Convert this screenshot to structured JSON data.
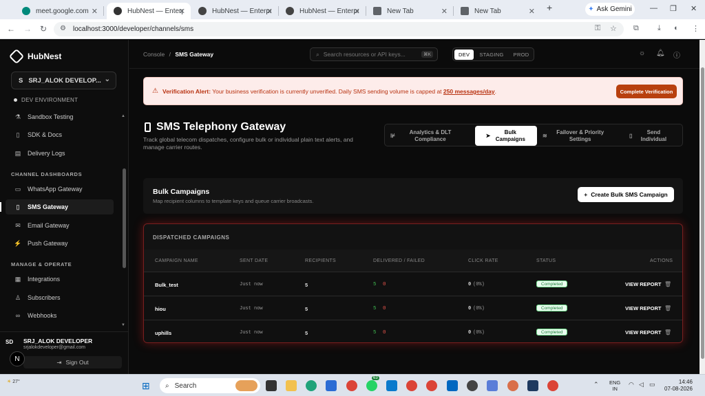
{
  "browser": {
    "tabs": [
      {
        "title": "meet.google.com",
        "active": false,
        "color": "#00897b"
      },
      {
        "title": "HubNest — Enterprise",
        "active": true,
        "color": "#333333"
      },
      {
        "title": "HubNest — Enterprise",
        "active": false,
        "color": "#333333"
      },
      {
        "title": "HubNest — Enterprise",
        "active": false,
        "color": "#333333"
      },
      {
        "title": "New Tab",
        "active": false,
        "color": "#5f6368"
      },
      {
        "title": "New Tab",
        "active": false,
        "color": "#5f6368"
      }
    ],
    "new_tab": "+",
    "gemini_label": "Ask Gemini",
    "url": "localhost:3000/developer/channels/sms"
  },
  "sidebar": {
    "brand": "HubNest",
    "org": "SRJ_ALOK DEVELOP...",
    "org_initial": "S",
    "env": "DEV ENVIRONMENT",
    "items_top": [
      {
        "label": "Sandbox Testing",
        "icon": "flask-icon"
      },
      {
        "label": "SDK & Docs",
        "icon": "book-icon"
      },
      {
        "label": "Delivery Logs",
        "icon": "file-icon"
      }
    ],
    "section_channels": "CHANNEL DASHBOARDS",
    "channels": [
      {
        "label": "WhatsApp Gateway",
        "icon": "chat-icon",
        "active": false
      },
      {
        "label": "SMS Gateway",
        "icon": "phone-icon",
        "active": true
      },
      {
        "label": "Email Gateway",
        "icon": "mail-icon",
        "active": false
      },
      {
        "label": "Push Gateway",
        "icon": "bolt-icon",
        "active": false
      }
    ],
    "section_manage": "MANAGE & OPERATE",
    "manage": [
      {
        "label": "Integrations",
        "icon": "grid-icon"
      },
      {
        "label": "Subscribers",
        "icon": "user-icon"
      },
      {
        "label": "Webhooks",
        "icon": "link-icon"
      }
    ],
    "user": {
      "initials": "SD",
      "name": "SRJ_ALOK DEVELOPER",
      "email": "srjalokdeveloper@gmail.com",
      "signout": "Sign Out"
    }
  },
  "topbar": {
    "crumb_root": "Console",
    "crumb_sep": "/",
    "crumb_current": "SMS Gateway",
    "search_placeholder": "Search resources or API keys...",
    "search_kbd": "⌘K",
    "envs": [
      "DEV",
      "STAGING",
      "PROD"
    ],
    "env_active": "DEV"
  },
  "alert": {
    "title": "Verification Alert:",
    "message": "Your business verification is currently unverified. Daily SMS sending volume is capped at",
    "cap": "250 messages/day",
    "end": ".",
    "button": "Complete Verification"
  },
  "page": {
    "title": "SMS Telephony Gateway",
    "subtitle": "Track global telecom dispatches, configure bulk or individual plain text alerts, and manage carrier routes.",
    "tabs": [
      {
        "label": "Analytics & DLT Compliance",
        "icon": "chart-icon",
        "active": false
      },
      {
        "label": "Bulk Campaigns",
        "icon": "send-icon",
        "active": true
      },
      {
        "label": "Failover & Priority Settings",
        "icon": "layers-icon",
        "active": false
      },
      {
        "label": "Send Individual",
        "icon": "phone-icon",
        "active": false
      }
    ]
  },
  "bulk": {
    "title": "Bulk Campaigns",
    "subtitle": "Map recipient columns to template keys and queue carrier broadcasts.",
    "create_button": "Create Bulk SMS Campaign"
  },
  "table": {
    "title": "DISPATCHED CAMPAIGNS",
    "columns": [
      "CAMPAIGN NAME",
      "SENT DATE",
      "RECIPIENTS",
      "DELIVERED / FAILED",
      "CLICK RATE",
      "STATUS",
      "ACTIONS"
    ],
    "rows": [
      {
        "name": "Bulk_test",
        "sent": "Just now",
        "recipients": "5",
        "delivered": "5",
        "failed": "0",
        "click_count": "0",
        "click_pct": "(0%)",
        "status": "Completed",
        "action": "VIEW REPORT"
      },
      {
        "name": "hiou",
        "sent": "Just now",
        "recipients": "5",
        "delivered": "5",
        "failed": "0",
        "click_count": "0",
        "click_pct": "(0%)",
        "status": "Completed",
        "action": "VIEW REPORT"
      },
      {
        "name": "uphills",
        "sent": "Just now",
        "recipients": "5",
        "delivered": "5",
        "failed": "0",
        "click_count": "0",
        "click_pct": "(0%)",
        "status": "Completed",
        "action": "VIEW REPORT"
      }
    ]
  },
  "taskbar": {
    "weather": "27°",
    "search": "Search",
    "badge": "63",
    "lang_top": "ENG",
    "lang_bottom": "IN",
    "time": "14:46",
    "date": "07-08-2026"
  }
}
